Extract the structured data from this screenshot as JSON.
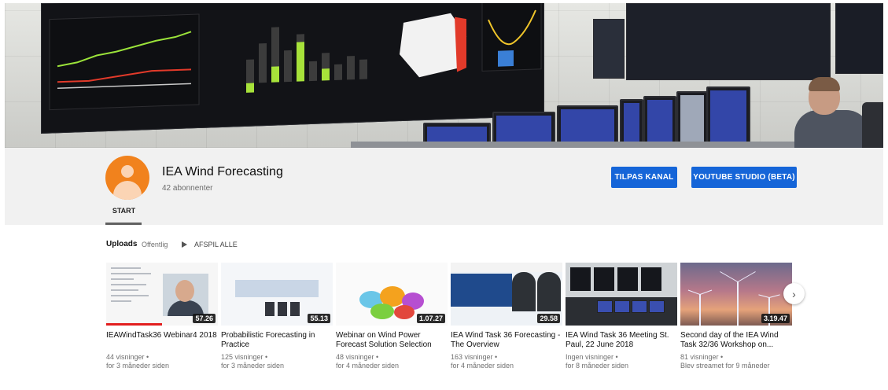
{
  "channel": {
    "name": "IEA Wind Forecasting",
    "subscribers": "42 abonnenter",
    "customize_label": "TILPAS KANAL",
    "studio_label": "YOUTUBE STUDIO (BETA)"
  },
  "tabs": [
    {
      "label": "START"
    }
  ],
  "uploads": {
    "title": "Uploads",
    "visibility": "Offentlig",
    "play_all": "AFSPIL ALLE",
    "videos": [
      {
        "title": "IEAWindTask36 Webinar4 2018",
        "duration": "57.26",
        "views": "44 visninger •",
        "age": "for 3 måneder siden",
        "progress": 0.5
      },
      {
        "title": "Probabilistic Forecasting in Practice",
        "duration": "55.13",
        "views": "125 visninger •",
        "age": "for 3 måneder siden"
      },
      {
        "title": "Webinar on Wind Power Forecast Solution Selection",
        "duration": "1.07.27",
        "views": "48 visninger •",
        "age": "for 4 måneder siden"
      },
      {
        "title": "IEA Wind Task 36 Forecasting - The Overview",
        "duration": "29.58",
        "views": "163 visninger •",
        "age": "for 4 måneder siden"
      },
      {
        "title": "IEA Wind Task 36 Meeting St. Paul, 22 June 2018",
        "duration": "",
        "views": "Ingen visninger •",
        "age": "for 8 måneder siden"
      },
      {
        "title": "Second day of the IEA Wind Task 32/36 Workshop on...",
        "duration": "3.19.47",
        "views": "81 visninger •",
        "age": "Blev streamet for 9 måneder"
      }
    ]
  },
  "colors": {
    "primary_button": "#1565d8",
    "avatar": "#f1821d",
    "header_bg": "#f1f1f1"
  },
  "icons": {
    "play_all": "play-icon",
    "next": "chevron-right-icon"
  }
}
